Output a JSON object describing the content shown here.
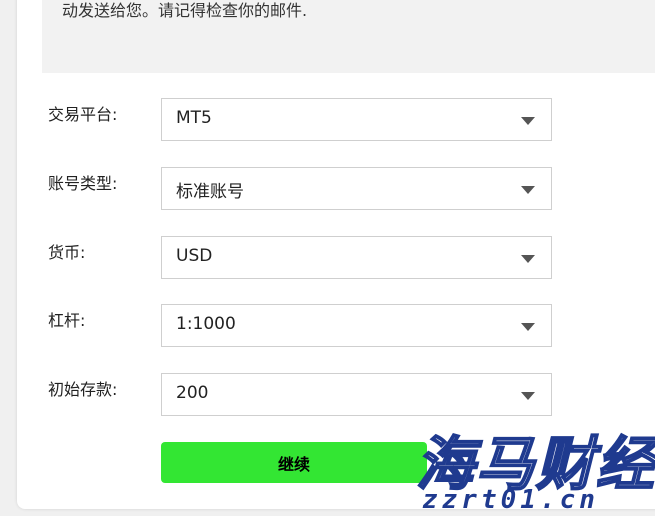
{
  "notice": {
    "text": "动发送给您。请记得检查你的邮件."
  },
  "form": {
    "fields": [
      {
        "label": "交易平台:",
        "value": "MT5"
      },
      {
        "label": "账号类型:",
        "value": "标准账号"
      },
      {
        "label": "货币:",
        "value": "USD"
      },
      {
        "label": "杠杆:",
        "value": "1:1000"
      },
      {
        "label": "初始存款:",
        "value": "200"
      }
    ],
    "continue_label": "继续"
  },
  "watermark": {
    "title": "海马财经",
    "url": "zzrt01.cn"
  },
  "colors": {
    "button": "#33e633",
    "watermark": "#1f3a8f"
  }
}
